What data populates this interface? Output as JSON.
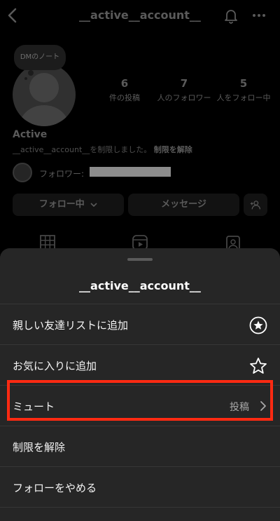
{
  "profile": {
    "username": "__active__account__",
    "note": "DMのノート",
    "stats": [
      {
        "num": "6",
        "label": "件の投稿"
      },
      {
        "num": "7",
        "label": "人のフォロワー"
      },
      {
        "num": "5",
        "label": "人をフォロー中"
      }
    ],
    "display_name": "Active",
    "restrict_notice": "__active__account__を制限しました。",
    "restrict_action": "制限を解除",
    "followers_label": "フォロワー:",
    "buttons": {
      "following": "フォロー中",
      "message": "メッセージ"
    }
  },
  "sheet": {
    "title": "__active__account__",
    "items": [
      {
        "label": "親しい友達リストに追加",
        "icon": "close-friends-star-icon"
      },
      {
        "label": "お気に入りに追加",
        "icon": "star-outline-icon"
      },
      {
        "label": "ミュート",
        "value": "投稿",
        "icon": "chevron-right-icon"
      },
      {
        "label": "制限を解除"
      },
      {
        "label": "フォローをやめる"
      }
    ]
  },
  "colors": {
    "highlight": "#ff2a12",
    "sheet_bg": "#262626"
  }
}
